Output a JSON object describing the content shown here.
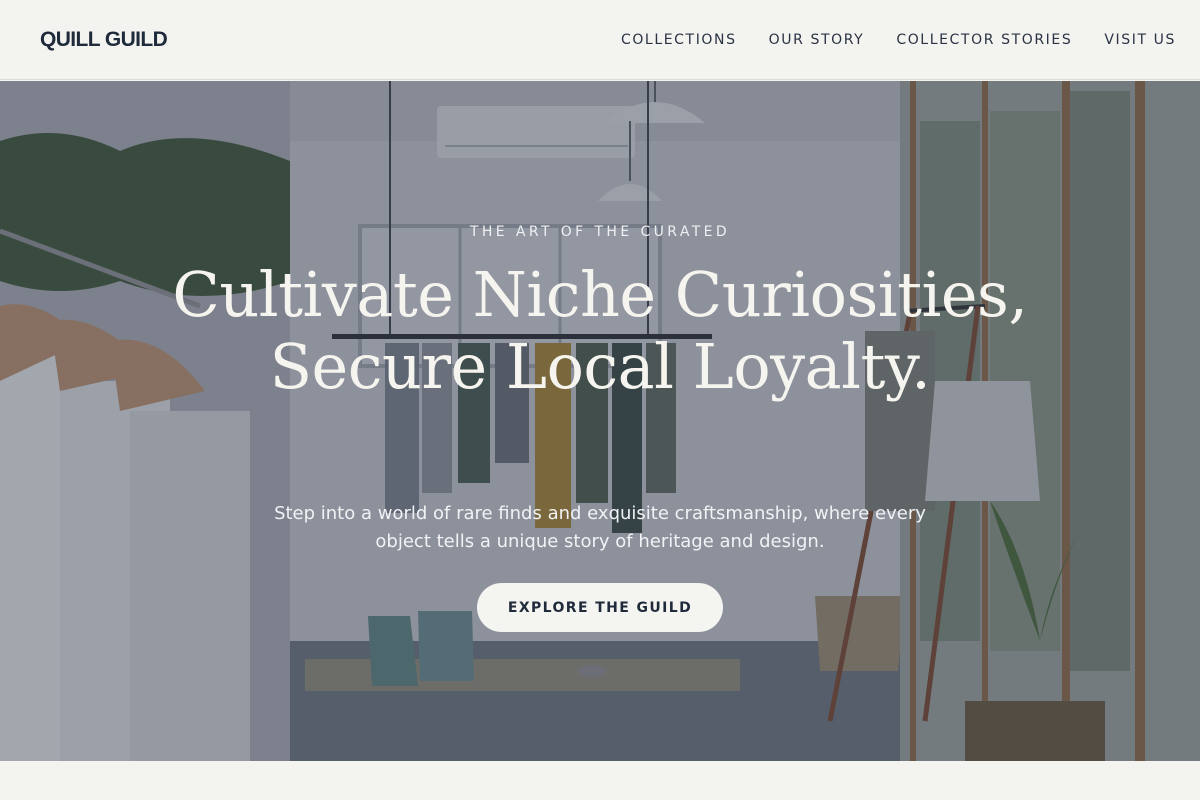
{
  "header": {
    "brand": "QUILL GUILD",
    "nav": [
      {
        "label": "COLLECTIONS"
      },
      {
        "label": "OUR STORY"
      },
      {
        "label": "COLLECTOR STORIES"
      },
      {
        "label": "VISIT US"
      }
    ]
  },
  "hero": {
    "eyebrow": "THE ART OF THE CURATED",
    "headline": "Cultivate Niche Curiosities, Secure Local Loyalty.",
    "subtext": "Step into a world of rare finds and exquisite craftsmanship, where every object tells a unique story of heritage and design.",
    "cta_label": "EXPLORE THE GUILD"
  },
  "colors": {
    "page_background": "#f3f3ef",
    "ink": "#1f2a3a",
    "hero_overlay": "#2a3242",
    "button_background": "#f4f4f0"
  }
}
